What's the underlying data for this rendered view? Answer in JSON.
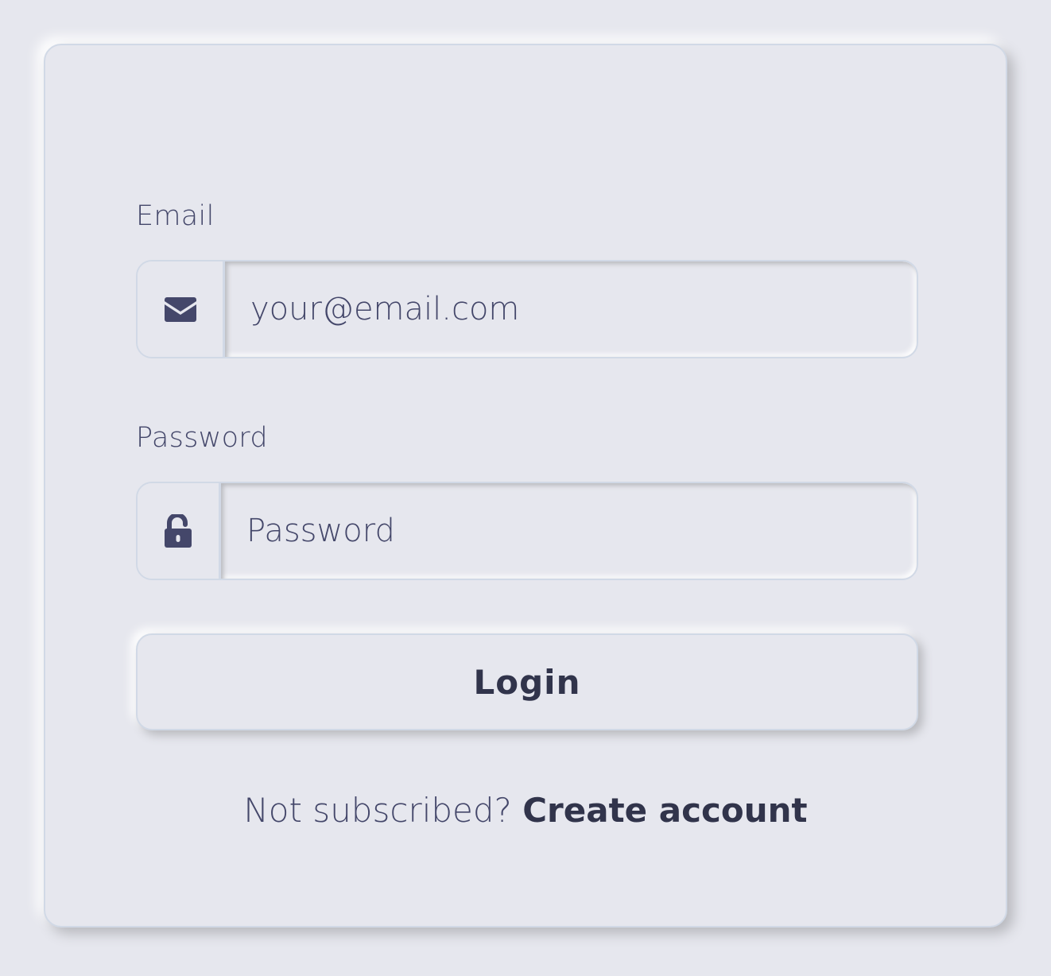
{
  "form": {
    "email_label": "Email",
    "email_placeholder": "your@email.com",
    "email_value": "",
    "password_label": "Password",
    "password_placeholder": "Password",
    "password_value": "",
    "login_label": "Login"
  },
  "icons": {
    "email_icon": "envelope-icon",
    "password_icon": "unlock-icon"
  },
  "footer": {
    "prompt_text": "Not subscribed?",
    "link_text": "Create account"
  },
  "colors": {
    "background": "#e6e7ee",
    "text": "#44476a",
    "text_dark": "#31344b",
    "border": "#d1d9e6"
  }
}
